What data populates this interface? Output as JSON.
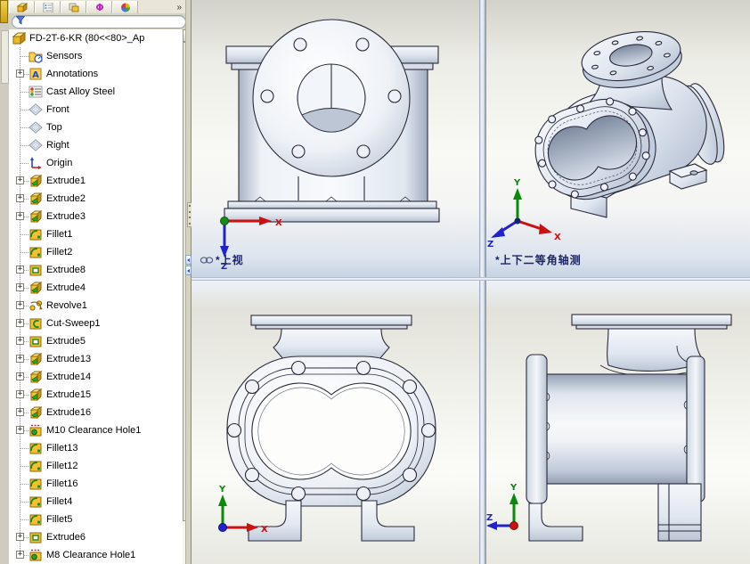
{
  "panel": {
    "tabs": [
      {
        "icon": "featuremanager-tab-icon"
      },
      {
        "icon": "propertymanager-tab-icon"
      },
      {
        "icon": "configurationmanager-tab-icon"
      },
      {
        "icon": "dimxpert-tab-icon"
      },
      {
        "icon": "displaymanager-tab-icon"
      }
    ],
    "tabs_overflow": "»",
    "filter": {
      "placeholder": ""
    },
    "tree": {
      "items": [
        {
          "label": "FD-2T-6-KR  (80<<80>_Ap",
          "icon": "part",
          "root": true,
          "expandable": false
        },
        {
          "label": "Sensors",
          "icon": "sensors",
          "expandable": false
        },
        {
          "label": "Annotations",
          "icon": "annotations",
          "expandable": true
        },
        {
          "label": "Cast Alloy Steel",
          "icon": "material",
          "expandable": false
        },
        {
          "label": "Front",
          "icon": "plane",
          "expandable": false
        },
        {
          "label": "Top",
          "icon": "plane",
          "expandable": false
        },
        {
          "label": "Right",
          "icon": "plane",
          "expandable": false
        },
        {
          "label": "Origin",
          "icon": "origin",
          "expandable": false
        },
        {
          "label": "Extrude1",
          "icon": "boss-extrude",
          "expandable": true
        },
        {
          "label": "Extrude2",
          "icon": "boss-extrude",
          "expandable": true
        },
        {
          "label": "Extrude3",
          "icon": "boss-extrude",
          "expandable": true
        },
        {
          "label": "Fillet1",
          "icon": "fillet",
          "expandable": false
        },
        {
          "label": "Fillet2",
          "icon": "fillet",
          "expandable": false
        },
        {
          "label": "Extrude8",
          "icon": "cut-extrude",
          "expandable": true
        },
        {
          "label": "Extrude4",
          "icon": "boss-extrude",
          "expandable": true
        },
        {
          "label": "Revolve1",
          "icon": "revolve",
          "expandable": true
        },
        {
          "label": "Cut-Sweep1",
          "icon": "cut-sweep",
          "expandable": true
        },
        {
          "label": "Extrude5",
          "icon": "cut-extrude",
          "expandable": true
        },
        {
          "label": "Extrude13",
          "icon": "boss-extrude",
          "expandable": true
        },
        {
          "label": "Extrude14",
          "icon": "boss-extrude",
          "expandable": true
        },
        {
          "label": "Extrude15",
          "icon": "boss-extrude",
          "expandable": true
        },
        {
          "label": "Extrude16",
          "icon": "boss-extrude",
          "expandable": true
        },
        {
          "label": "M10 Clearance Hole1",
          "icon": "hole-wizard",
          "expandable": true
        },
        {
          "label": "Fillet13",
          "icon": "fillet",
          "expandable": false
        },
        {
          "label": "Fillet12",
          "icon": "fillet",
          "expandable": false
        },
        {
          "label": "Fillet16",
          "icon": "fillet",
          "expandable": false
        },
        {
          "label": "Fillet4",
          "icon": "fillet",
          "expandable": false
        },
        {
          "label": "Fillet5",
          "icon": "fillet",
          "expandable": false
        },
        {
          "label": "Extrude6",
          "icon": "cut-extrude",
          "expandable": true
        },
        {
          "label": "M8 Clearance Hole1",
          "icon": "hole-wizard",
          "expandable": true
        }
      ]
    }
  },
  "viewports": {
    "top_left": {
      "label": "*上视"
    },
    "top_right": {
      "label": "*上下二等角轴测"
    }
  },
  "axis": {
    "x": "X",
    "y": "Y",
    "z": "Z"
  },
  "colors": {
    "viewport_label": "#1c2566",
    "panel_tan": "#d6d2c2",
    "splitter_blue": "#8c9bb0",
    "part_fill": "#dfe6f0",
    "part_outline": "#2a2a3a",
    "axis_x": "#cc1111",
    "axis_y": "#0a8a0a",
    "axis_z": "#2222cc"
  }
}
